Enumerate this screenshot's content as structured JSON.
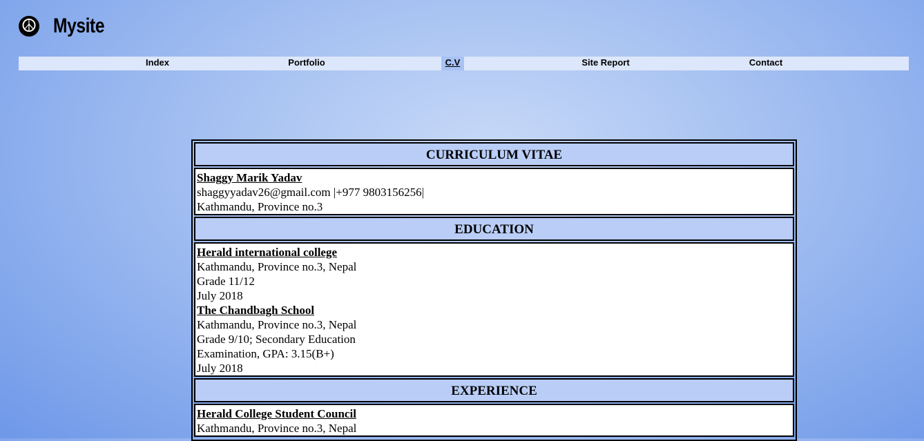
{
  "site": {
    "title": "Mysite",
    "logo_icon": "peace-sign-icon"
  },
  "nav": {
    "items": [
      {
        "label": "Index"
      },
      {
        "label": "Portfolio"
      },
      {
        "label": "C.V"
      },
      {
        "label": "Site Report"
      },
      {
        "label": "Contact"
      }
    ],
    "active": "C.V"
  },
  "cv": {
    "title": "CURRICULUM VITAE",
    "person": {
      "name": "Shaggy Marik Yadav",
      "contact": "shaggyyadav26@gmail.com |+977 9803156256|",
      "address": "Kathmandu, Province no.3"
    },
    "education": {
      "heading": "EDUCATION",
      "entries": [
        {
          "name": "Herald international college",
          "lines": [
            "Kathmandu, Province no.3, Nepal",
            "Grade 11/12",
            "July 2018"
          ]
        },
        {
          "name": "The Chandbagh School",
          "lines": [
            "Kathmandu, Province no.3, Nepal",
            "Grade 9/10; Secondary Education",
            "Examination, GPA: 3.15(B+)",
            "July 2018"
          ]
        }
      ]
    },
    "experience": {
      "heading": "EXPERIENCE",
      "entries": [
        {
          "name": "Herald College Student Council",
          "lines": [
            "Kathmandu, Province no.3, Nepal"
          ]
        }
      ]
    }
  },
  "colors": {
    "background": "#8fb0ee",
    "nav_bar": "#dde7fb",
    "nav_active": "#a8c2f3",
    "section_header": "#b9cdf6"
  }
}
